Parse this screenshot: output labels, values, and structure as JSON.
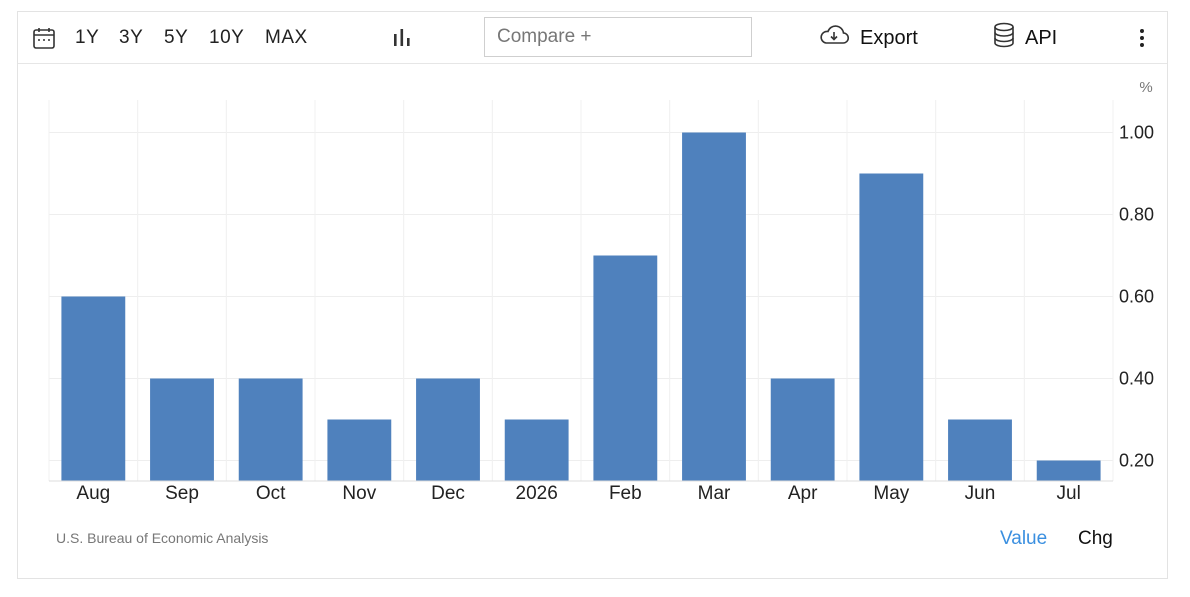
{
  "toolbar": {
    "ranges": [
      "1Y",
      "3Y",
      "5Y",
      "10Y",
      "MAX"
    ],
    "compare_placeholder": "Compare +",
    "export_label": "Export",
    "api_label": "API"
  },
  "source": "U.S. Bureau of Economic Analysis",
  "toggles": {
    "value": "Value",
    "chg": "Chg"
  },
  "colors": {
    "bar": "#4f81bd",
    "active_toggle": "#3a8fe0"
  },
  "chart_data": {
    "type": "bar",
    "unit": "%",
    "categories": [
      "Aug",
      "Sep",
      "Oct",
      "Nov",
      "Dec",
      "2026",
      "Feb",
      "Mar",
      "Apr",
      "May",
      "Jun",
      "Jul"
    ],
    "values": [
      0.6,
      0.4,
      0.4,
      0.3,
      0.4,
      0.3,
      0.7,
      1.0,
      0.4,
      0.9,
      0.3,
      0.2
    ],
    "yticks": [
      "1.00",
      "0.80",
      "0.60",
      "0.40",
      "0.20"
    ],
    "ylim": [
      0.15,
      1.05
    ],
    "grid": true
  }
}
